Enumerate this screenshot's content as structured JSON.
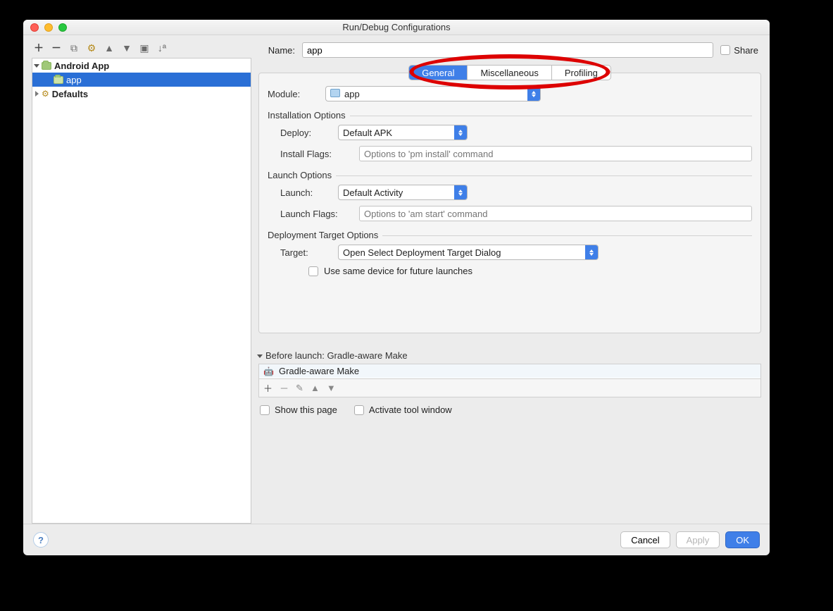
{
  "window": {
    "title": "Run/Debug Configurations"
  },
  "tree": {
    "root": "Android App",
    "child": "app",
    "defaults": "Defaults"
  },
  "name": {
    "label": "Name:",
    "value": "app",
    "share": "Share"
  },
  "tabs": {
    "general": "General",
    "misc": "Miscellaneous",
    "profiling": "Profiling"
  },
  "module": {
    "label": "Module:",
    "value": "app"
  },
  "install": {
    "group": "Installation Options",
    "deploy_label": "Deploy:",
    "deploy_value": "Default APK",
    "flags_label": "Install Flags:",
    "flags_placeholder": "Options to 'pm install' command"
  },
  "launch": {
    "group": "Launch Options",
    "launch_label": "Launch:",
    "launch_value": "Default Activity",
    "flags_label": "Launch Flags:",
    "flags_placeholder": "Options to 'am start' command"
  },
  "target": {
    "group": "Deployment Target Options",
    "target_label": "Target:",
    "target_value": "Open Select Deployment Target Dialog",
    "reuse_label": "Use same device for future launches"
  },
  "before": {
    "header": "Before launch: Gradle-aware Make",
    "item": "Gradle-aware Make",
    "show_page": "Show this page",
    "activate": "Activate tool window"
  },
  "buttons": {
    "cancel": "Cancel",
    "apply": "Apply",
    "ok": "OK"
  }
}
